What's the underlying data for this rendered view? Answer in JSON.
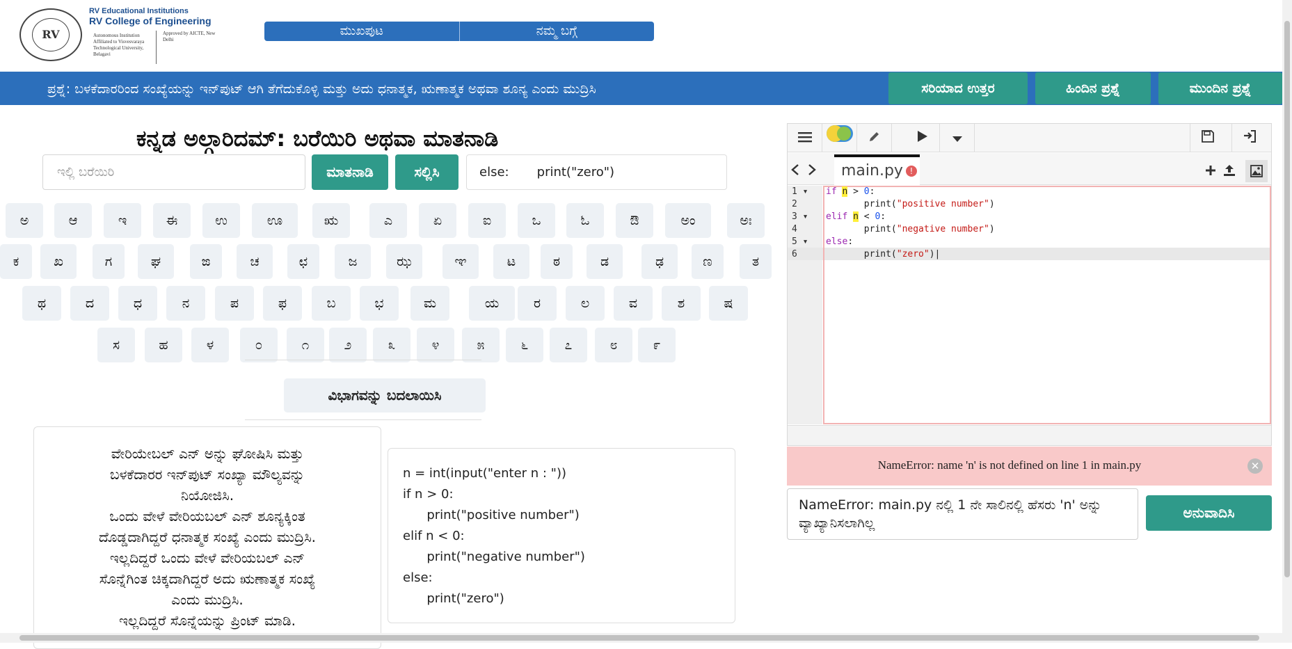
{
  "header": {
    "org_group": "RV Educational Institutions",
    "org_name": "RV College of Engineering",
    "org_affil": "Autonomous Institution Affiliated to Visvesvaraya Technological University, Belagavi",
    "org_approved": "Approved by AICTE, New Delhi",
    "seal_text": "RV",
    "nav": [
      "ಮುಖಪುಟ",
      "ನಮ್ಮ ಬಗ್ಗೆ"
    ]
  },
  "question": {
    "text": "ಪ್ರಶ್ನೆ: ಬಳಕೆದಾರರಿಂದ ಸಂಖ್ಯೆಯನ್ನು ಇನ್‌ಪುಟ್ ಆಗಿ ತೆಗೆದುಕೊಳ್ಳಿ ಮತ್ತು ಅದು ಧನಾತ್ಮಕ, ಋಣಾತ್ಮಕ ಅಥವಾ ಶೂನ್ಯ ಎಂದು ಮುದ್ರಿಸಿ",
    "correct_answer": "ಸರಿಯಾದ ಉತ್ತರ",
    "previous": "ಹಿಂದಿನ ಪ್ರಶ್ನೆ",
    "next": "ಮುಂದಿನ ಪ್ರಶ್ನೆ"
  },
  "main": {
    "title": "ಕನ್ನಡ ಅಲ್ಗಾರಿದಮ್: ಬರೆಯಿರಿ ಅಥವಾ ಮಾತನಾಡಿ",
    "input_placeholder": "ಇಲ್ಲಿ ಬರೆಯಿರಿ",
    "speak_button": "ಮಾತನಾಡಿ",
    "submit_button": "ಸಲ್ಲಿಸಿ",
    "output_preview": "else:       print(\"zero\")",
    "change_section_button": "ವಿಭಾಗವನ್ನು ಬದಲಾಯಿಸಿ"
  },
  "keyboard": {
    "row1": [
      "ಅ",
      "ಆ",
      "ಇ",
      "ಈ",
      "ಉ",
      "ಊ",
      "ಋ",
      "ಎ",
      "ಏ",
      "ಐ",
      "ಒ",
      "ಓ",
      "ಔ",
      "ಅಂ",
      "ಅಃ"
    ],
    "row2": [
      "ಕ",
      "ಖ",
      "ಗ",
      "ಘ",
      "ಙ",
      "ಚ",
      "ಛ",
      "ಜ",
      "ಝ",
      "ಞ",
      "ಟ",
      "ಠ",
      "ಡ",
      "ಢ",
      "ಣ",
      "ತ"
    ],
    "row3": [
      "ಥ",
      "ದ",
      "ಧ",
      "ನ",
      "ಪ",
      "ಫ",
      "ಬ",
      "ಭ",
      "ಮ",
      "ಯ",
      "ರ",
      "ಲ",
      "ವ",
      "ಶ",
      "ಷ"
    ],
    "row4": [
      "ಸ",
      "ಹ",
      "ಳ",
      "೦",
      "೧",
      "೨",
      "೩",
      "೪",
      "೫",
      "೬",
      "೭",
      "೮",
      "೯"
    ]
  },
  "description": [
    "ವೇರಿಯೇಬಲ್ ಎನ್ ಅನ್ನು ಘೋಷಿಸಿ ಮತ್ತು",
    "ಬಳಕೆದಾರರ ಇನ್‌ಪುಟ್ ಸಂಖ್ಯಾ ಮೌಲ್ಯವನ್ನು",
    "ನಿಯೋಜಿಸಿ.",
    "ಒಂದು ವೇಳೆ ವೇರಿಯಬಲ್ ಎನ್ ಶೂನ್ಯಕ್ಕಿಂತ",
    "ದೊಡ್ಡದಾಗಿದ್ದರೆ ಧನಾತ್ಮಕ ಸಂಖ್ಯೆ ಎಂದು ಮುದ್ರಿಸಿ.",
    "ಇಲ್ಲದಿದ್ದರೆ ಒಂದು ವೇಳೆ ವೇರಿಯಬಲ್ ಎನ್",
    "ಸೊನ್ನೆಗಿಂತ ಚಿಕ್ಕದಾಗಿದ್ದರೆ ಅದು ಋಣಾತ್ಮಕ ಸಂಖ್ಯೆ",
    "ಎಂದು ಮುದ್ರಿಸಿ.",
    "ಇಲ್ಲದಿದ್ದರೆ ಸೊನ್ನೆಯನ್ನು ಪ್ರಿಂಟ್ ಮಾಡಿ."
  ],
  "converted_code": [
    "n = int(input(\"enter n : \"))",
    "if n > 0:",
    "      print(\"positive number\")",
    "elif n < 0:",
    "      print(\"negative number\")",
    "else:",
    "      print(\"zero\")"
  ],
  "editor": {
    "tab_name": "main.py",
    "tab_error_badge": "!",
    "line_numbers": [
      "1",
      "2",
      "3",
      "4",
      "5",
      "6"
    ]
  },
  "error": {
    "message": "NameError: name 'n' is not defined on line 1 in main.py",
    "translation": "NameError: main.py ನಲ್ಲಿ 1 ನೇ ಸಾಲಿನಲ್ಲಿ ಹೆಸರು 'n' ಅನ್ನು ವ್ಯಾಖ್ಯಾನಿಸಲಾಗಿಲ್ಲ",
    "translate_button": "ಅನುವಾದಿಸಿ"
  },
  "colors": {
    "brand_blue": "#2c6fbb",
    "teal": "#2f9a8a",
    "error_bg": "#f9c9c9"
  },
  "icons": [
    "menu-icon",
    "key-icon",
    "pencil-icon",
    "play-icon",
    "caret-down-icon",
    "save-icon",
    "sign-in-icon",
    "chevron-left-icon",
    "chevron-right-icon",
    "plus-icon",
    "upload-icon",
    "image-icon",
    "close-circle-icon"
  ]
}
